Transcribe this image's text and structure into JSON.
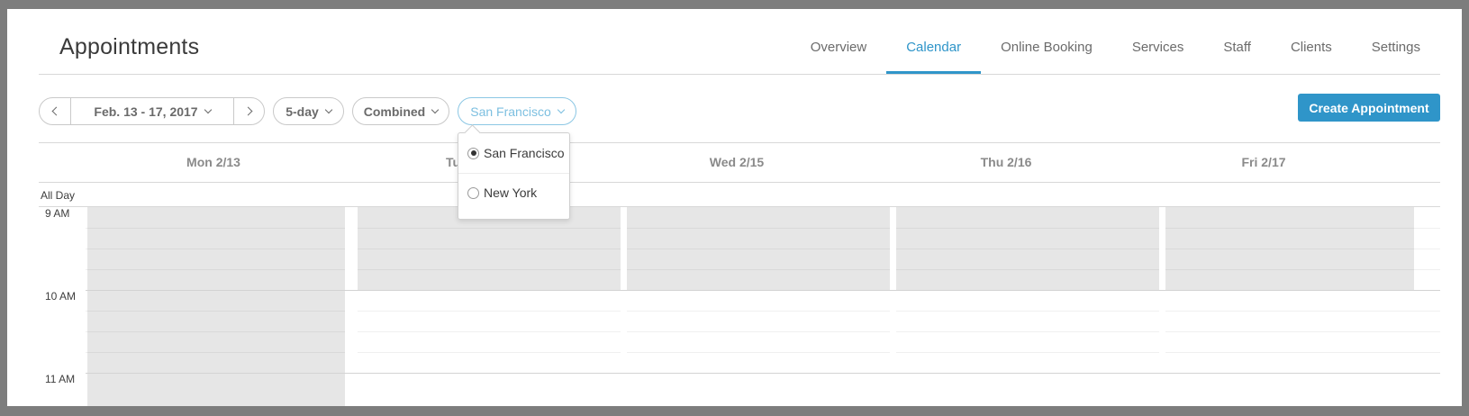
{
  "header": {
    "title": "Appointments",
    "tabs": [
      {
        "label": "Overview",
        "active": false
      },
      {
        "label": "Calendar",
        "active": true
      },
      {
        "label": "Online Booking",
        "active": false
      },
      {
        "label": "Services",
        "active": false
      },
      {
        "label": "Staff",
        "active": false
      },
      {
        "label": "Clients",
        "active": false
      },
      {
        "label": "Settings",
        "active": false
      }
    ]
  },
  "toolbar": {
    "date_range": "Feb. 13 - 17, 2017",
    "view": "5-day",
    "staff_filter": "Combined",
    "location": "San Francisco",
    "create_label": "Create Appointment"
  },
  "location_dropdown": {
    "options": [
      {
        "label": "San Francisco",
        "selected": true
      },
      {
        "label": "New York",
        "selected": false
      }
    ]
  },
  "calendar": {
    "days": [
      "Mon 2/13",
      "Tu",
      "Wed 2/15",
      "Thu 2/16",
      "Fri 2/17"
    ],
    "all_day_label": "All Day",
    "hours": [
      "9 AM",
      "10 AM",
      "11 AM"
    ]
  },
  "colors": {
    "accent": "#2f95c9",
    "unavailable": "#e6e6e6"
  }
}
